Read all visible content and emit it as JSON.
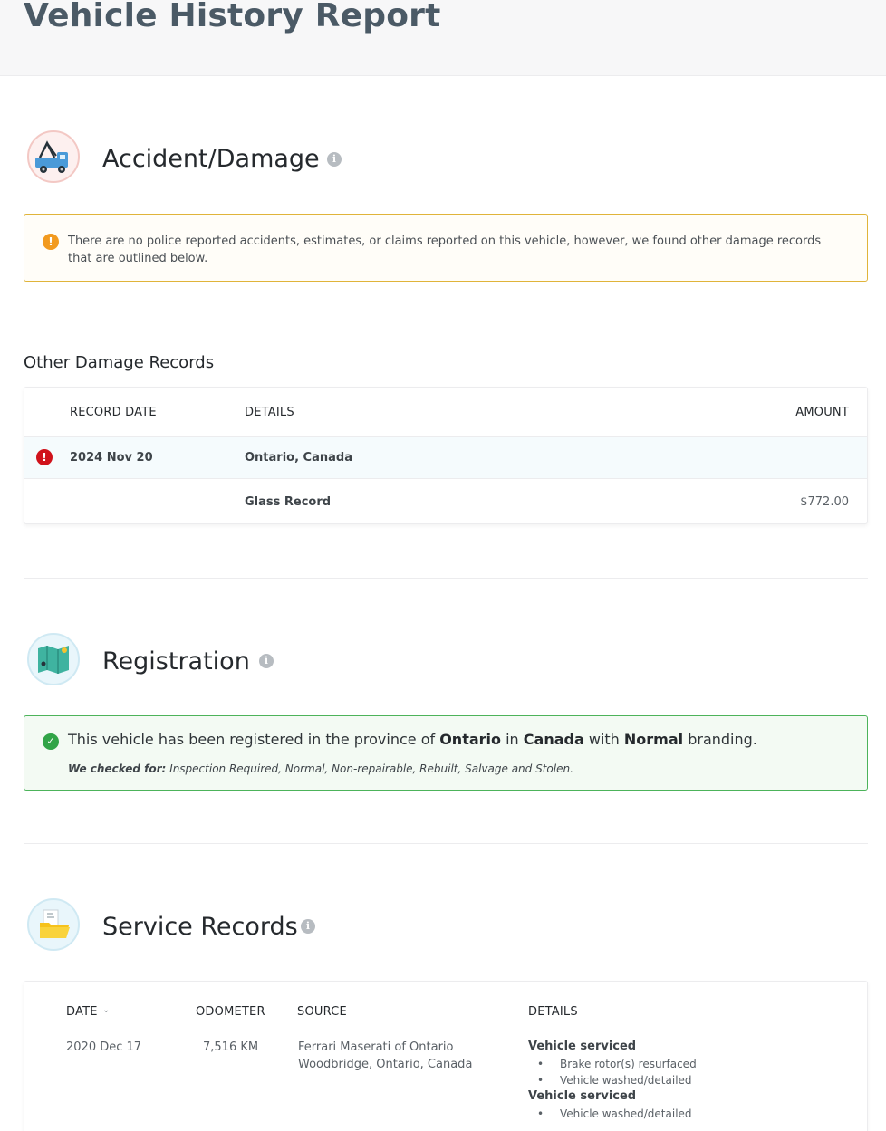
{
  "page": {
    "title": "Vehicle History Report"
  },
  "accident": {
    "title": "Accident/Damage",
    "notice": "There are no police reported accidents, estimates, or claims reported on this vehicle, however, we found other damage records that are outlined below.",
    "other_damage_title": "Other Damage Records",
    "columns": [
      "RECORD DATE",
      "DETAILS",
      "AMOUNT"
    ],
    "record": {
      "date": "2024 Nov 20",
      "location": "Ontario, Canada",
      "item": "Glass Record",
      "amount": "$772.00"
    }
  },
  "registration": {
    "title": "Registration",
    "sentence_start": "This vehicle has been registered in the province of ",
    "province": "Ontario",
    "in_word": " in ",
    "country": "Canada",
    "with_word": " with ",
    "branding": "Normal",
    "sentence_end": " branding.",
    "checked_label": "We checked for:",
    "checked_list": " Inspection Required, Normal, Non-repairable, Rebuilt, Salvage and Stolen."
  },
  "service": {
    "title": "Service Records",
    "columns": [
      "DATE",
      "ODOMETER",
      "SOURCE",
      "DETAILS"
    ],
    "record": {
      "date": "2020 Dec 17",
      "odometer": "7,516 KM",
      "source_line1": "Ferrari Maserati of Ontario",
      "source_line2": "Woodbridge, Ontario, Canada",
      "detail_groups": [
        {
          "title": "Vehicle serviced",
          "items": [
            "Brake rotor(s) resurfaced",
            "Vehicle washed/detailed"
          ]
        },
        {
          "title": "Vehicle serviced",
          "items": [
            "Vehicle washed/detailed"
          ]
        }
      ]
    }
  },
  "icons": {
    "accident": "tow-truck-icon",
    "registration": "map-icon",
    "service": "folder-icon",
    "info": "info-icon",
    "warning": "warning-icon",
    "error": "error-icon",
    "success": "check-icon",
    "sort": "chevron-down-icon"
  },
  "colors": {
    "warning": "#f29a1f",
    "error": "#d0121b",
    "success": "#31a447",
    "warning_border": "#e0b43a",
    "success_border": "#4cb35a"
  }
}
